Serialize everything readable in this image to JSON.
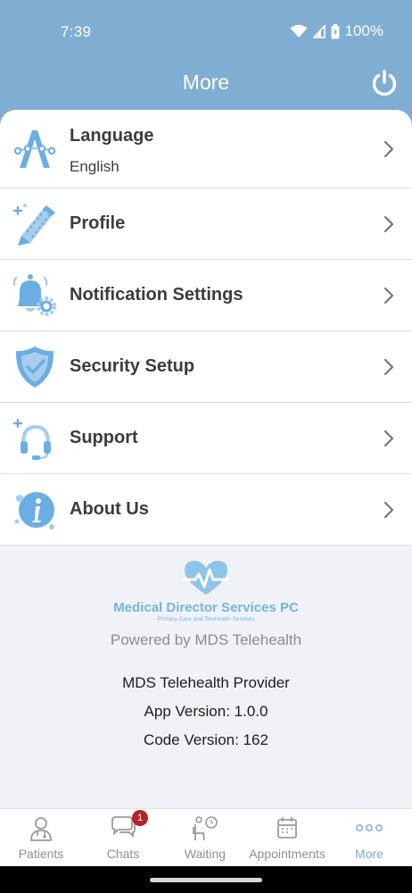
{
  "status_bar": {
    "time": "7:39",
    "battery": "100%"
  },
  "header": {
    "title": "More"
  },
  "menu": {
    "items": [
      {
        "label": "Language",
        "sublabel": "English"
      },
      {
        "label": "Profile"
      },
      {
        "label": "Notification Settings"
      },
      {
        "label": "Security Setup"
      },
      {
        "label": "Support"
      },
      {
        "label": "About Us"
      }
    ]
  },
  "footer": {
    "logo_title": "Medical Director Services PC",
    "logo_subtitle": "Primary Care and Telehealth Services",
    "powered_by": "Powered by MDS Telehealth",
    "app_name": "MDS Telehealth Provider",
    "app_version": "App Version: 1.0.0",
    "code_version": "Code Version: 162"
  },
  "tabbar": {
    "tabs": [
      {
        "label": "Patients"
      },
      {
        "label": "Chats",
        "badge": "1"
      },
      {
        "label": "Waiting"
      },
      {
        "label": "Appointments"
      },
      {
        "label": "More"
      }
    ]
  },
  "colors": {
    "header": "#80add2",
    "accent": "#7aa9cf",
    "icon_blue": "#6aaee3",
    "badge": "#b3232a"
  },
  "icons": [
    "language-icon",
    "profile-pencil-icon",
    "bell-gear-icon",
    "shield-check-icon",
    "headset-icon",
    "info-icon",
    "power-icon",
    "chevron-right-icon"
  ]
}
